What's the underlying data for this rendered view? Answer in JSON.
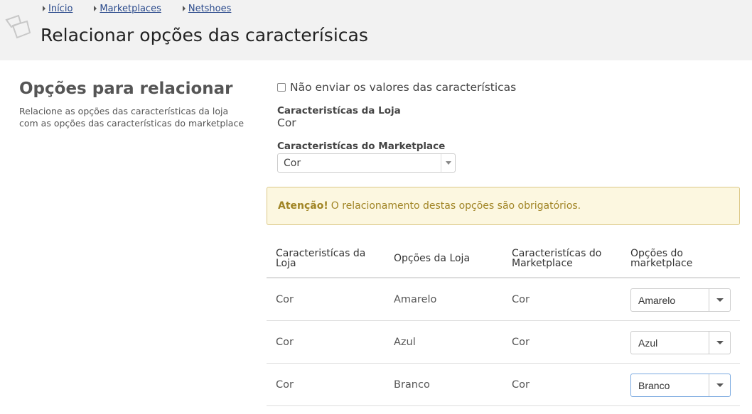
{
  "breadcrumb": [
    "Início",
    "Marketplaces",
    "Netshoes"
  ],
  "page": {
    "title": "Relacionar opções das caracterísicas"
  },
  "left": {
    "title": "Opções para relacionar",
    "description": "Relacione as opções das características da loja com as opções das características do marketplace"
  },
  "form": {
    "checkbox_label": "Não enviar os valores das características",
    "store_char_label": "Caracteristícas da Loja",
    "store_char_value": "Cor",
    "mp_char_label": "Caracteristícas do Marketplace",
    "mp_char_selected": "Cor"
  },
  "alert": {
    "strong": "Atenção!",
    "text": "O relacionamento destas opções são obrigatórios."
  },
  "table": {
    "headers": [
      "Caracteristícas da Loja",
      "Opções da Loja",
      "Caracteristícas do Marketplace",
      "Opções do marketplace"
    ],
    "rows": [
      {
        "store_char": "Cor",
        "store_option": "Amarelo",
        "mp_char": "Cor",
        "mp_option": "Amarelo"
      },
      {
        "store_char": "Cor",
        "store_option": "Azul",
        "mp_char": "Cor",
        "mp_option": "Azul"
      },
      {
        "store_char": "Cor",
        "store_option": "Branco",
        "mp_char": "Cor",
        "mp_option": "Branco"
      }
    ]
  }
}
